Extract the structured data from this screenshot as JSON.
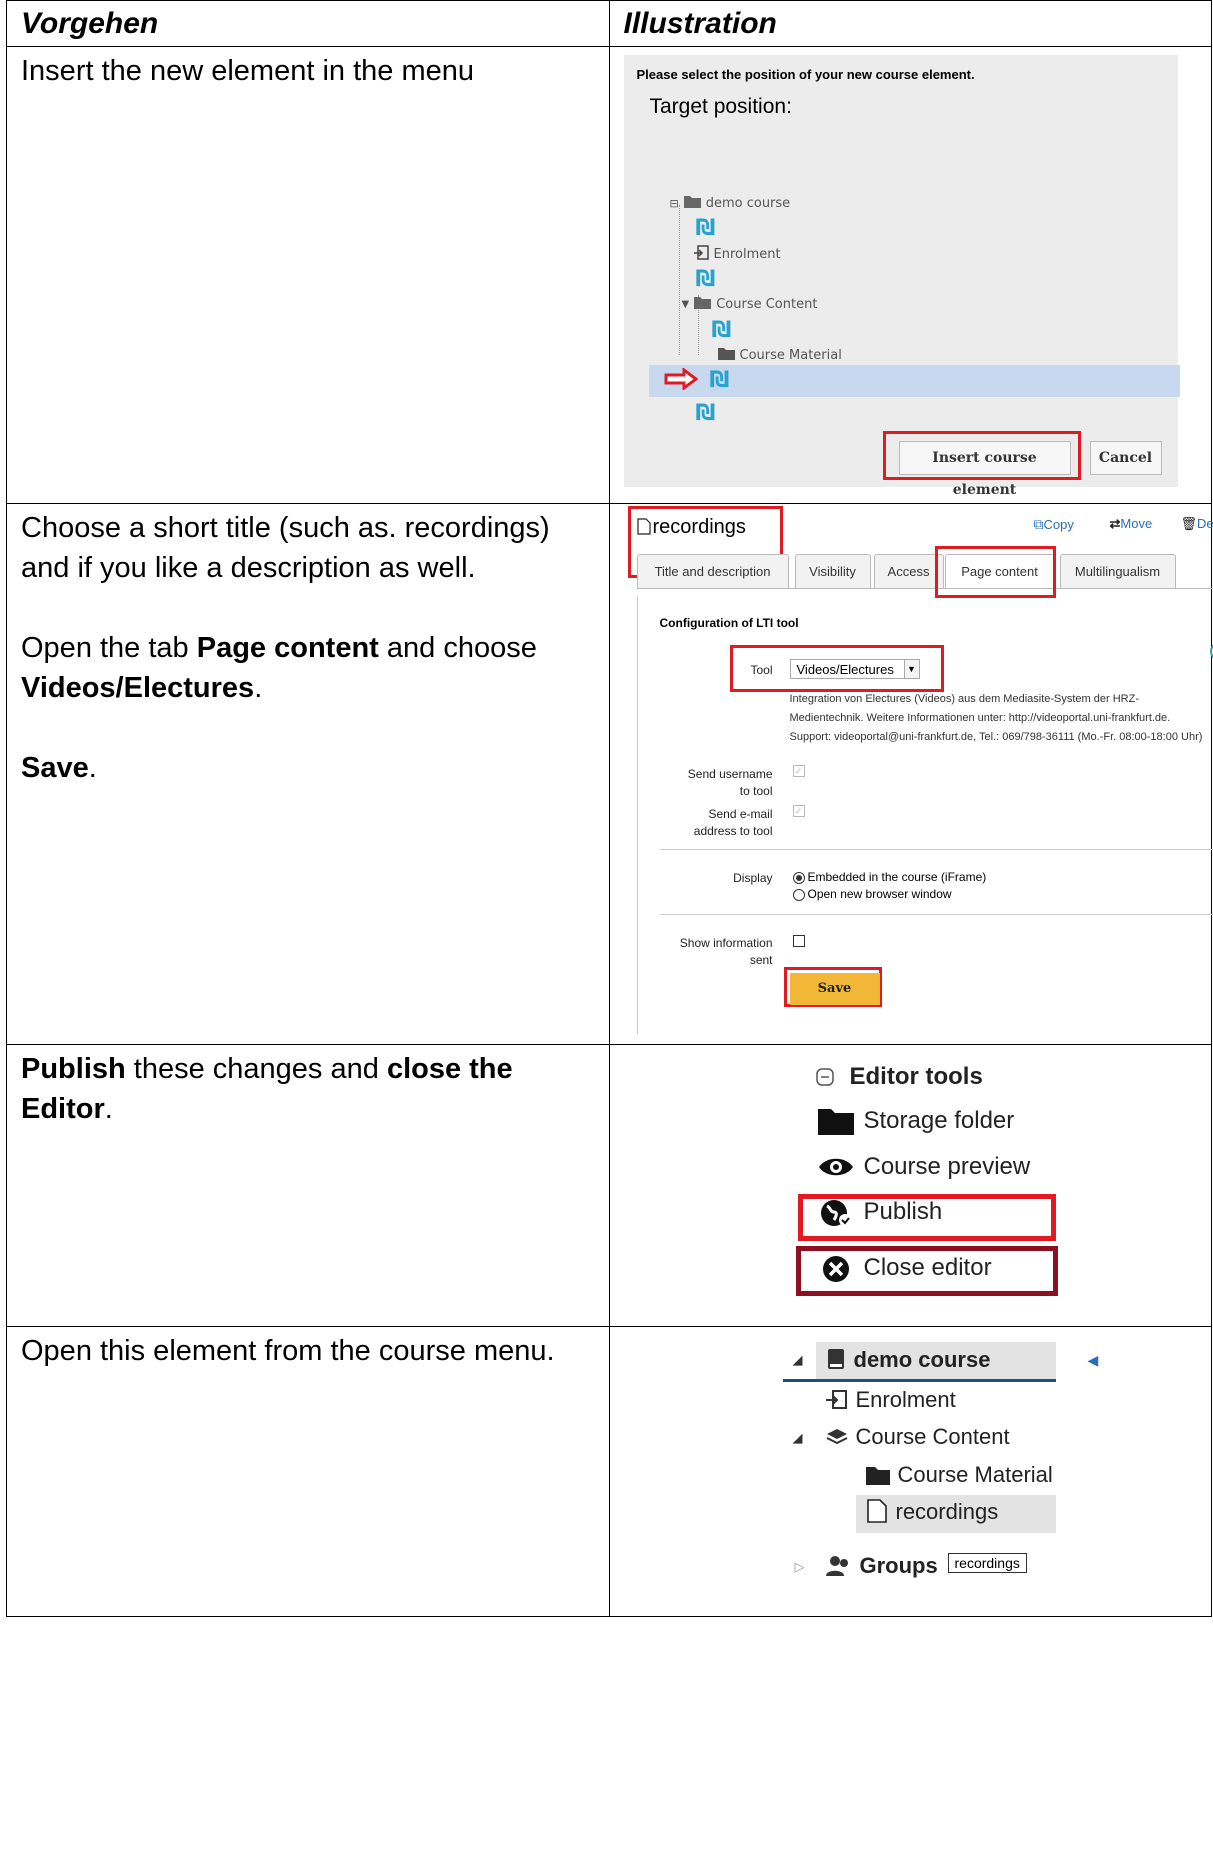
{
  "header": {
    "col1": "Vorgehen",
    "col2": "Illustration"
  },
  "row1": {
    "text": "Insert the new element in the menu",
    "dialog": {
      "heading": "Please select the position of your new course element.",
      "target_label": "Target position:",
      "tree": [
        "demo course",
        "Enrolment",
        "Course Content",
        "Course Material"
      ],
      "insert_button": "Insert course element",
      "cancel_button": "Cancel"
    }
  },
  "row2": {
    "text1": "Choose a short title  (such as. recordings) and if you like a description as well.",
    "text2_pre": "Open the tab ",
    "text2_bold1": "Page content",
    "text2_mid": " and choose ",
    "text2_bold2": "Videos/Electures",
    "text2_post": ".",
    "text3_bold": "Save",
    "text3_post": ".",
    "config": {
      "title": "recordings",
      "actions": {
        "copy": "Copy",
        "move": "Move",
        "delete": "Delete"
      },
      "tabs": [
        "Title and description",
        "Visibility",
        "Access",
        "Page content",
        "Multilingualism"
      ],
      "section_title": "Configuration of LTI tool",
      "tool_label": "Tool",
      "tool_value": "Videos/Electures",
      "info_lines": [
        "Integration von Electures (Videos) aus dem Mediasite-System der HRZ-",
        "Medientechnik. Weitere Informationen unter: http://videoportal.uni-frankfurt.de.",
        "Support: videoportal@uni-frankfurt.de, Tel.: 069/798-36111 (Mo.-Fr. 08:00-18:00 Uhr)"
      ],
      "send_username_l1": "Send username",
      "send_username_l2": "to tool",
      "send_email_l1": "Send e-mail",
      "send_email_l2": "address to tool",
      "display_label": "Display",
      "display_opt1": "Embedded in the course (iFrame)",
      "display_opt2": "Open new browser window",
      "show_info_l1": "Show information",
      "show_info_l2": "sent",
      "save_button": "Save"
    }
  },
  "row3": {
    "text_bold1": "Publish",
    "text_mid": " these changes and ",
    "text_bold2": "close the Editor",
    "text_post": ".",
    "tools": {
      "heading": "Editor tools",
      "items": [
        "Storage folder",
        "Course preview",
        "Publish",
        "Close editor"
      ]
    }
  },
  "row4": {
    "text": "Open this element from the course menu.",
    "menu": {
      "root": "demo course",
      "items": [
        "Enrolment",
        "Course Content",
        "Course Material",
        "recordings"
      ],
      "groups": "Groups",
      "badge": "recordings"
    }
  },
  "colors": {
    "frame_red": "#e01b24",
    "frame_dark": "#8b1020",
    "insert_blue": "#2aa3cc",
    "save_yellow": "#f2b736",
    "highlight_row": "#c8d8ef"
  }
}
